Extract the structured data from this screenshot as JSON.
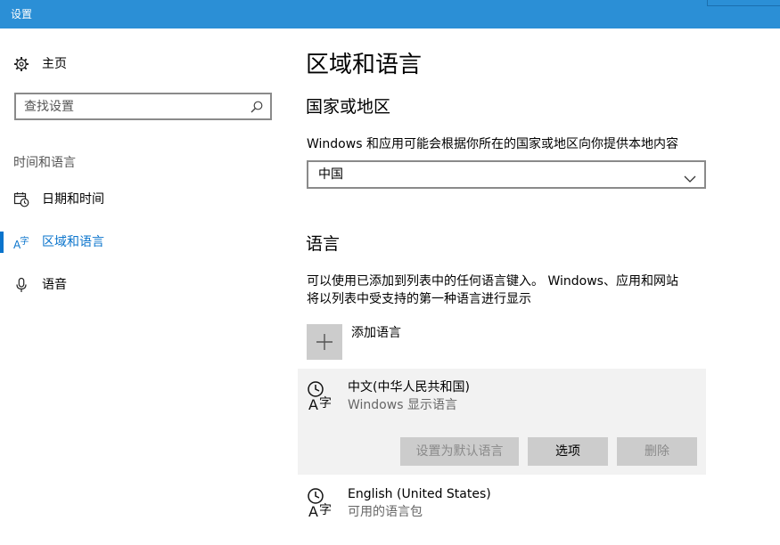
{
  "window": {
    "title": "设置"
  },
  "sidebar": {
    "home": {
      "label": "主页",
      "icon": "gear-icon"
    },
    "search": {
      "placeholder": "查找设置",
      "icon": "search-icon"
    },
    "section_label": "时间和语言",
    "items": [
      {
        "label": "日期和时间",
        "icon": "calendar-clock-icon",
        "active": false
      },
      {
        "label": "区域和语言",
        "icon": "region-language-icon",
        "active": true
      },
      {
        "label": "语音",
        "icon": "microphone-icon",
        "active": false
      }
    ]
  },
  "main": {
    "title": "区域和语言",
    "region": {
      "heading": "国家或地区",
      "description": "Windows 和应用可能会根据你所在的国家或地区向你提供本地内容",
      "selected": "中国"
    },
    "language": {
      "heading": "语言",
      "description_line1": "可以使用已添加到列表中的任何语言键入。 Windows、应用和网站",
      "description_line2": "将以列表中受支持的第一种语言进行显示",
      "add_label": "添加语言",
      "items": [
        {
          "name": "中文(中华人民共和国)",
          "subtitle": "Windows 显示语言",
          "icon": "language-pack-icon"
        },
        {
          "name": "English (United States)",
          "subtitle": "可用的语言包",
          "icon": "language-pack-icon"
        }
      ],
      "buttons": {
        "set_default": "设置为默认语言",
        "options": "选项",
        "remove": "删除"
      }
    }
  },
  "colors": {
    "accent": "#0a74cc",
    "titlebar": "#2b8fd6",
    "button": "#cccccc",
    "selected_row": "#f2f2f2"
  }
}
